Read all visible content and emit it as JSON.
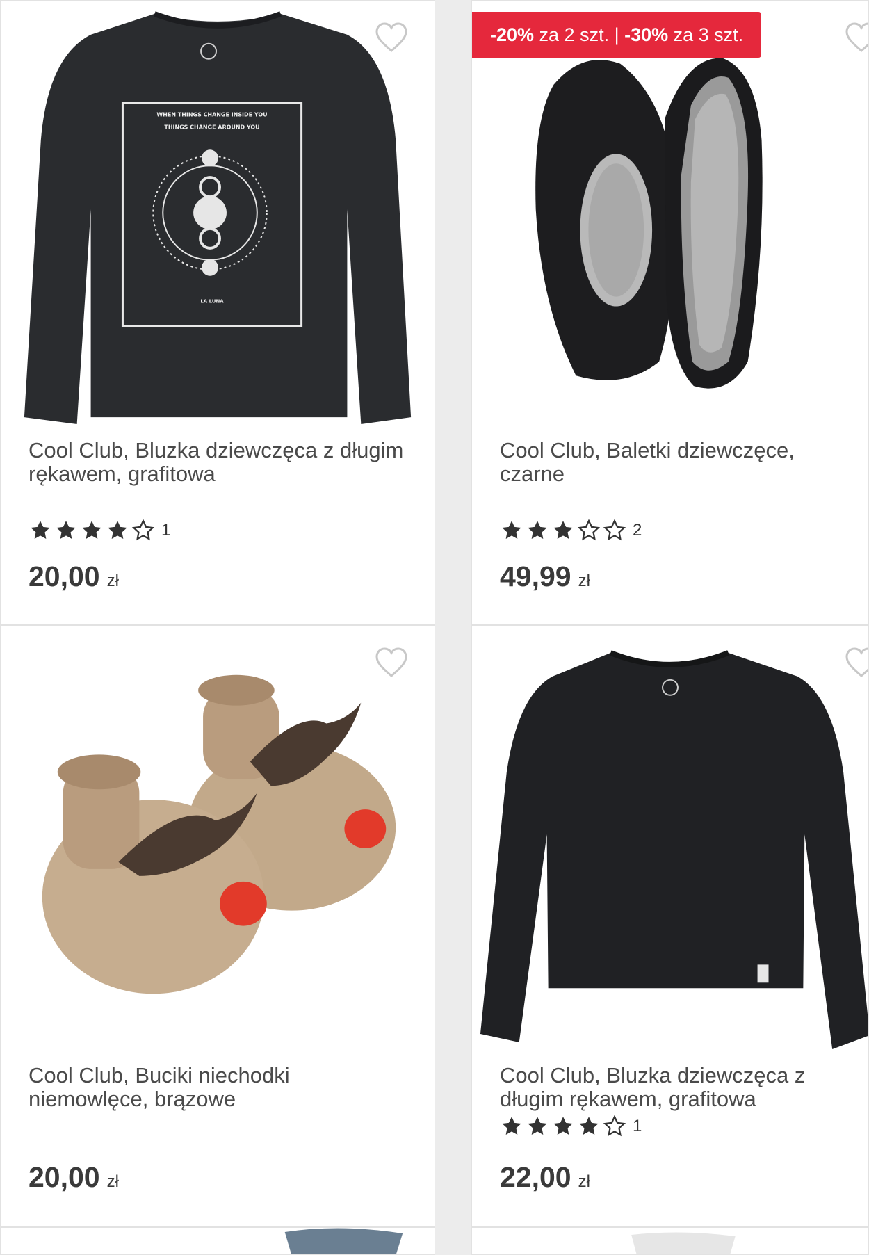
{
  "products": [
    {
      "title": "Cool Club, Bluzka dziewczęca z długim rękawem, grafitowa",
      "rating_count": "1",
      "stars_filled": 4,
      "price": "20,00",
      "currency": "zł",
      "print_text_1": "WHEN THINGS CHANGE INSIDE YOU",
      "print_text_2": "THINGS CHANGE AROUND YOU",
      "print_text_3": "LA LUNA"
    },
    {
      "title": "Cool Club, Baletki dziewczęce, czarne",
      "rating_count": "2",
      "stars_filled": 3,
      "price": "49,99",
      "currency": "zł",
      "promo": {
        "discount1": "-20%",
        "text1": " za 2 szt. | ",
        "discount2": "-30%",
        "text2": " za 3 szt."
      }
    },
    {
      "title": "Cool Club, Buciki niechodki niemowlęce, brązowe",
      "price": "20,00",
      "currency": "zł"
    },
    {
      "title": "Cool Club, Bluzka dziewczęca z długim rękawem, grafitowa",
      "rating_count": "1",
      "stars_filled": 4,
      "price": "22,00",
      "currency": "zł"
    }
  ],
  "colors": {
    "promo_bg": "#e5283c",
    "star": "#333333",
    "heart_outline": "#c8c8c8"
  },
  "icons": {
    "favorite": "heart-outline-icon",
    "star_full": "star-filled-icon",
    "star_empty": "star-outline-icon"
  }
}
